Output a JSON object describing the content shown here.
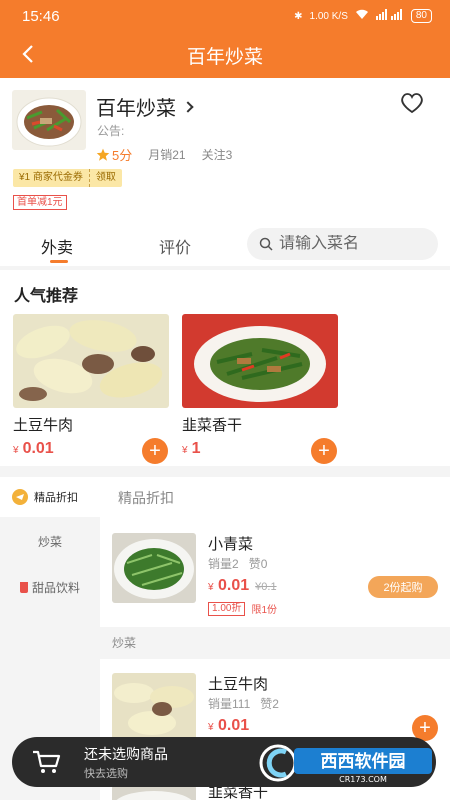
{
  "status_bar": {
    "time": "15:46",
    "net_speed": "1.00 K/S",
    "battery": "80"
  },
  "nav": {
    "title": "百年炒菜"
  },
  "shop": {
    "name": "百年炒菜",
    "notice": "公告:",
    "score": "5分",
    "monthly_sales": "月销21",
    "followers": "关注3",
    "coupon_label": "¥1 商家代金券",
    "coupon_action": "领取",
    "promo": "首单减1元"
  },
  "tabs": [
    {
      "label": "外卖"
    },
    {
      "label": "评价"
    }
  ],
  "search": {
    "placeholder": "请输入菜名"
  },
  "popular": {
    "title": "人气推荐",
    "items": [
      {
        "name": "土豆牛肉",
        "currency": "¥",
        "price": "0.01"
      },
      {
        "name": "韭菜香干",
        "currency": "¥",
        "price": "1"
      }
    ]
  },
  "menu": {
    "header_left": "精品折扣",
    "header_right": "精品折扣",
    "categories": [
      "炒菜",
      "甜品饮料"
    ],
    "items": [
      {
        "name": "小青菜",
        "sales": "销量2",
        "likes": "赞0",
        "currency": "¥",
        "price": "0.01",
        "old_price": "¥0.1",
        "discount": "1.00折",
        "limit": "限1份",
        "min_label": "2份起购"
      },
      {
        "name": "土豆牛肉",
        "sales": "销量111",
        "likes": "赞2",
        "currency": "¥",
        "price": "0.01"
      },
      {
        "name": "韭菜香干"
      }
    ],
    "section_label": "炒菜"
  },
  "cart": {
    "title": "还未选购商品",
    "subtitle": "快去选购"
  },
  "watermark": {
    "text": "西西软件园",
    "domain": "CR173.COM"
  },
  "colors": {
    "brand": "#f57c2c",
    "price": "#e9514a"
  }
}
